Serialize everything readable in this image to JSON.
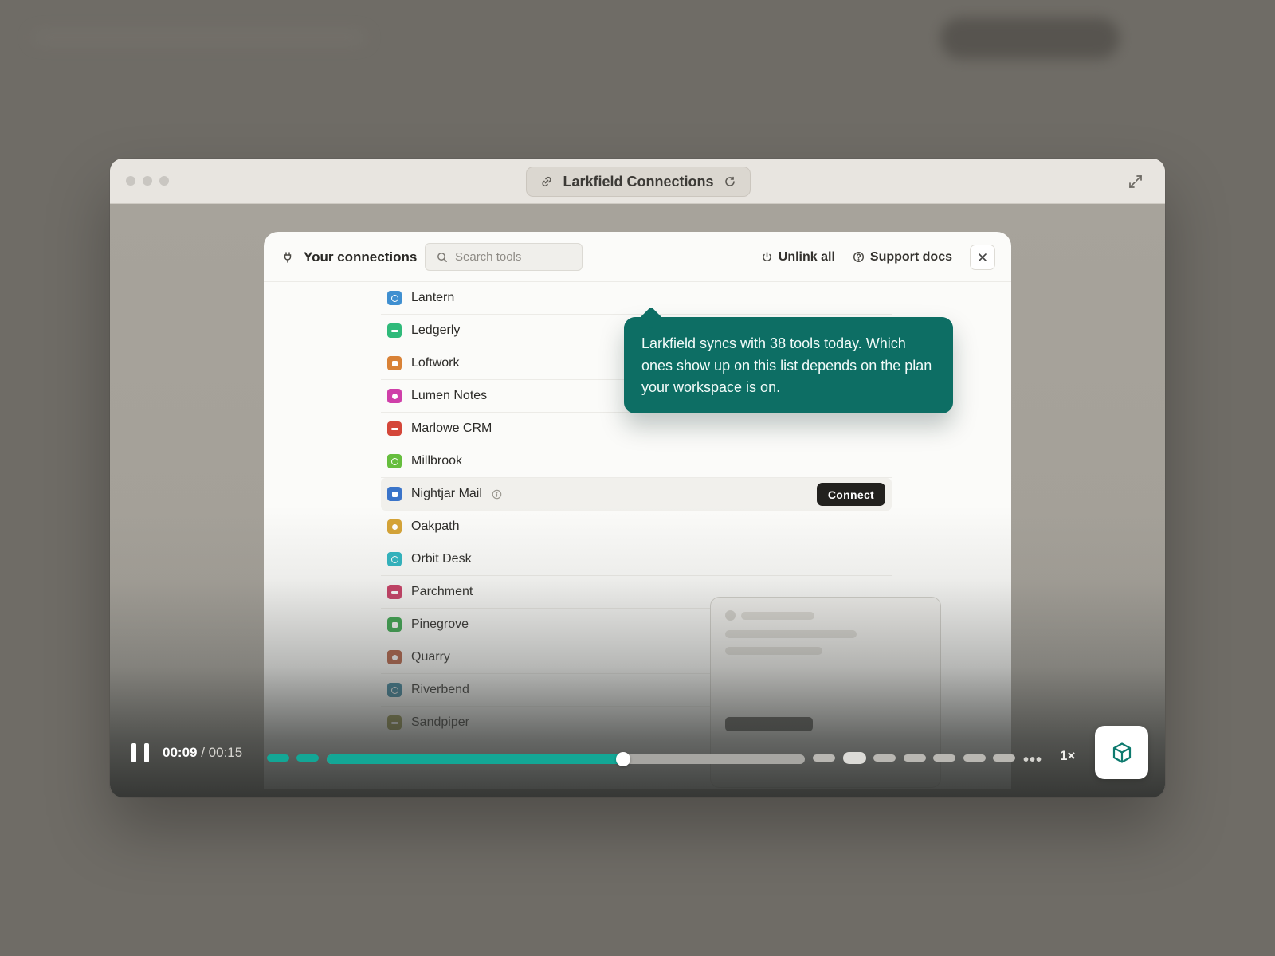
{
  "window": {
    "title": "Larkfield Connections"
  },
  "modal": {
    "title": "Your connections",
    "search_placeholder": "Search tools",
    "unlink_all": "Unlink all",
    "support_docs": "Support docs"
  },
  "tooltip": {
    "text": "Larkfield syncs with 38 tools today. Which ones show up on this list depends on the plan your workspace is on."
  },
  "connections": [
    {
      "label": "Lantern",
      "color": "#3f8fd0",
      "glyph": "ring"
    },
    {
      "label": "Ledgerly",
      "color": "#2fba7a",
      "glyph": "dash"
    },
    {
      "label": "Loftwork",
      "color": "#d98236",
      "glyph": "sq"
    },
    {
      "label": "Lumen Notes",
      "color": "#cf3fa9",
      "glyph": "dot"
    },
    {
      "label": "Marlowe CRM",
      "color": "#d4473a",
      "glyph": "dash"
    },
    {
      "label": "Millbrook",
      "color": "#66be3e",
      "glyph": "ring"
    },
    {
      "label": "Nightjar Mail",
      "color": "#3a74c9",
      "glyph": "sq",
      "highlighted": true,
      "action": "Connect"
    },
    {
      "label": "Oakpath",
      "color": "#d6a436",
      "glyph": "dot"
    },
    {
      "label": "Orbit Desk",
      "color": "#2fb6c1",
      "glyph": "ring"
    },
    {
      "label": "Parchment",
      "color": "#c93b63",
      "glyph": "dash"
    },
    {
      "label": "Pinegrove",
      "color": "#36a64a",
      "glyph": "sq"
    },
    {
      "label": "Quarry",
      "color": "#b15a3c",
      "glyph": "dot"
    },
    {
      "label": "Riverbend",
      "color": "#2f7e99",
      "glyph": "ring"
    },
    {
      "label": "Sandpiper",
      "color": "#8c8b3c",
      "glyph": "dash"
    }
  ],
  "player": {
    "current_time": "00:09",
    "total_time": "00:15",
    "separator": " / ",
    "progress": 0.62,
    "speed": "1×"
  },
  "icons": {
    "link": "link-icon",
    "reload": "reload-icon",
    "expand": "expand-icon",
    "plug": "plug-icon",
    "search": "search-icon",
    "power": "power-icon",
    "help": "help-circle-icon",
    "close": "close-icon",
    "info": "info-icon",
    "pause": "pause-icon",
    "brand": "cube-icon"
  },
  "colors": {
    "accent": "#0d6e64",
    "progress": "#13a796"
  }
}
